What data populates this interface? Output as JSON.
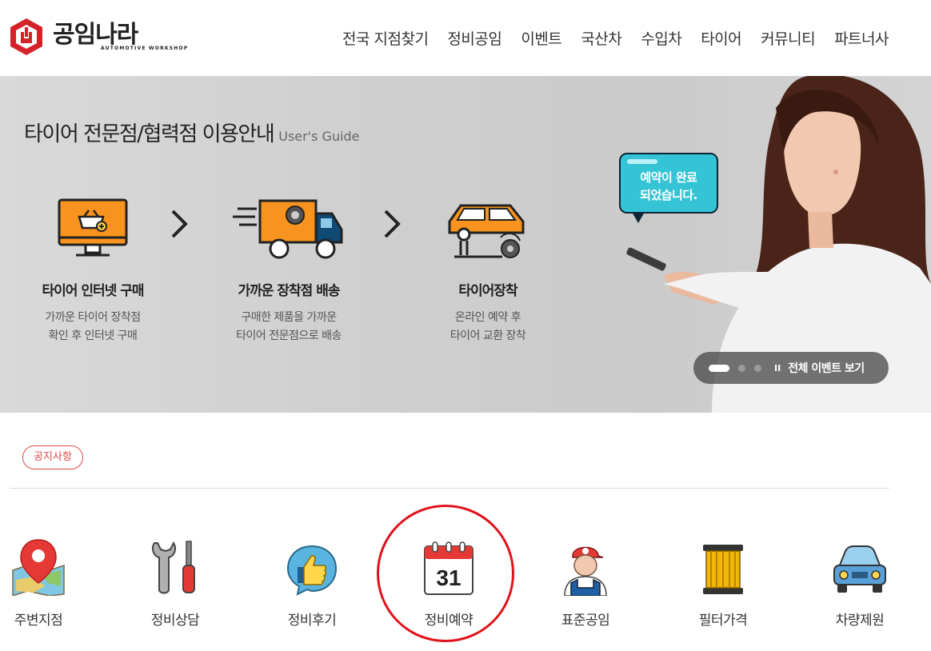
{
  "header": {
    "logo_name": "공임나라",
    "logo_sub": "AUTOMOTIVE WORKSHOP",
    "nav": [
      "전국 지점찾기",
      "정비공임",
      "이벤트",
      "국산차",
      "수입차",
      "타이어",
      "커뮤니티",
      "파트너사"
    ]
  },
  "banner": {
    "title": "타이어 전문점/협력점 이용안내",
    "subtitle": "User's Guide",
    "steps": [
      {
        "title": "타이어 인터넷 구매",
        "desc1": "가까운 타이어 장착점",
        "desc2": "확인 후 인터넷 구매",
        "icon": "monitor-basket-icon"
      },
      {
        "title": "가까운 장착점 배송",
        "desc1": "구매한 제품을 가까운",
        "desc2": "타이어 전문점으로 배송",
        "icon": "delivery-truck-icon"
      },
      {
        "title": "타이어장착",
        "desc1": "온라인 예약 후",
        "desc2": "타이어 교환 장착",
        "icon": "car-lift-icon"
      }
    ],
    "bubble_line1": "예약이 완료",
    "bubble_line2": "되었습니다.",
    "pager_pause": "II",
    "all_events": "전체 이벤트 보기"
  },
  "notice_label": "공지사항",
  "quick": [
    {
      "label": "주변지점",
      "icon": "map-pin-icon"
    },
    {
      "label": "정비상담",
      "icon": "wrench-screwdriver-icon"
    },
    {
      "label": "정비후기",
      "icon": "thumbs-up-icon"
    },
    {
      "label": "정비예약",
      "icon": "calendar-icon",
      "calendar_day": "31"
    },
    {
      "label": "표준공임",
      "icon": "mechanic-icon"
    },
    {
      "label": "필터가격",
      "icon": "filter-icon"
    },
    {
      "label": "차량제원",
      "icon": "car-icon"
    }
  ],
  "colors": {
    "brand_red": "#d5232a",
    "accent_orange": "#f7931e",
    "highlight_circle": "#e0121b"
  }
}
